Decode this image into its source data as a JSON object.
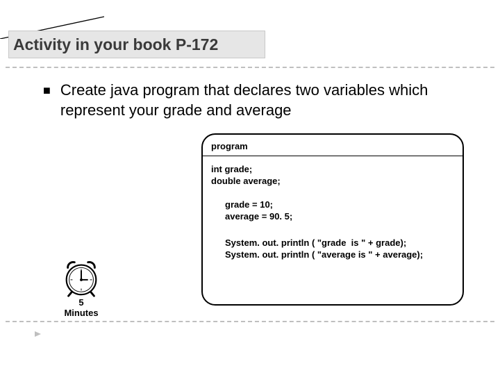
{
  "title": "Activity in your book P-172",
  "bullet": "Create java program that declares two variables which represent your grade and average",
  "code": {
    "header": "program",
    "decl1": "int grade;",
    "decl2": "double average;",
    "assign1": "grade = 10;",
    "assign2": "average = 90. 5;",
    "print1": "System. out. println ( \"grade  is \" + grade);",
    "print2": "System. out. println ( \"average is \" + average);"
  },
  "clock": {
    "line1": "5",
    "line2": "Minutes"
  }
}
